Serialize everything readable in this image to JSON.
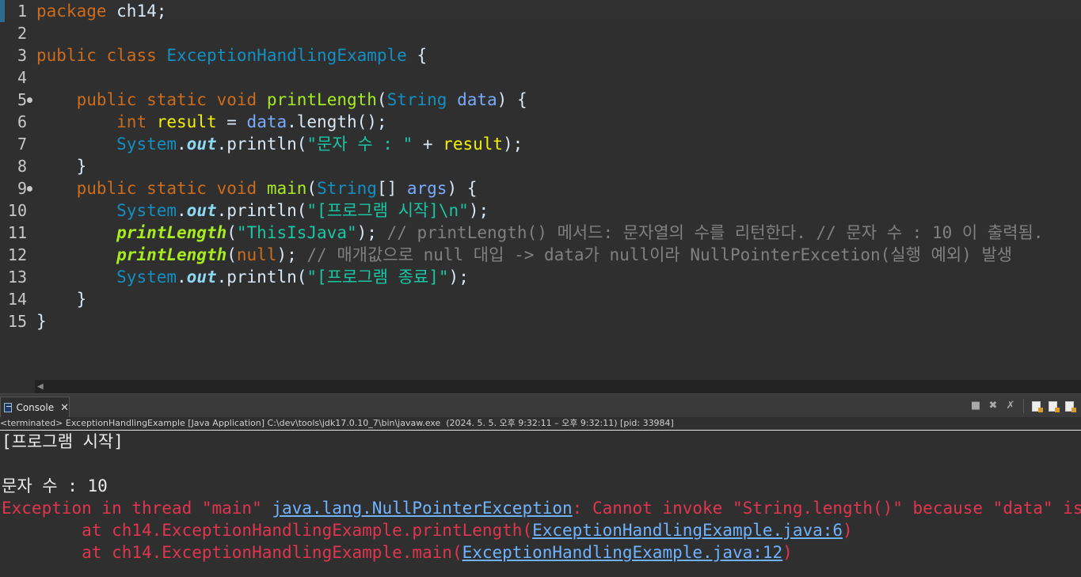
{
  "editor": {
    "lines": [
      {
        "num": "1",
        "tokens": [
          [
            "kw",
            "package"
          ],
          [
            "plain",
            " ch14;"
          ]
        ]
      },
      {
        "num": "2",
        "tokens": []
      },
      {
        "num": "3",
        "tokens": [
          [
            "kw",
            "public"
          ],
          [
            "plain",
            " "
          ],
          [
            "kw",
            "class"
          ],
          [
            "plain",
            " "
          ],
          [
            "cls",
            "ExceptionHandlingExample"
          ],
          [
            "plain",
            " {"
          ]
        ]
      },
      {
        "num": "4",
        "tokens": []
      },
      {
        "num": "5",
        "fold": true,
        "tokens": [
          [
            "plain",
            "    "
          ],
          [
            "kw",
            "public"
          ],
          [
            "plain",
            " "
          ],
          [
            "kw",
            "static"
          ],
          [
            "plain",
            " "
          ],
          [
            "kw",
            "void"
          ],
          [
            "plain",
            " "
          ],
          [
            "meth",
            "printLength"
          ],
          [
            "plain",
            "("
          ],
          [
            "type",
            "String"
          ],
          [
            "plain",
            " "
          ],
          [
            "param",
            "data"
          ],
          [
            "plain",
            ") {"
          ]
        ]
      },
      {
        "num": "6",
        "tokens": [
          [
            "plain",
            "        "
          ],
          [
            "kw",
            "int"
          ],
          [
            "plain",
            " "
          ],
          [
            "local",
            "result"
          ],
          [
            "plain",
            " = "
          ],
          [
            "param",
            "data"
          ],
          [
            "plain",
            ".length();"
          ]
        ]
      },
      {
        "num": "7",
        "tokens": [
          [
            "plain",
            "        "
          ],
          [
            "type",
            "System"
          ],
          [
            "plain",
            "."
          ],
          [
            "sfield",
            "out"
          ],
          [
            "plain",
            ".println("
          ],
          [
            "str",
            "\"문자 수 : \""
          ],
          [
            "plain",
            " + "
          ],
          [
            "local",
            "result"
          ],
          [
            "plain",
            ");"
          ]
        ]
      },
      {
        "num": "8",
        "tokens": [
          [
            "plain",
            "    }"
          ]
        ]
      },
      {
        "num": "9",
        "fold": true,
        "tokens": [
          [
            "plain",
            "    "
          ],
          [
            "kw",
            "public"
          ],
          [
            "plain",
            " "
          ],
          [
            "kw",
            "static"
          ],
          [
            "plain",
            " "
          ],
          [
            "kw",
            "void"
          ],
          [
            "plain",
            " "
          ],
          [
            "meth",
            "main"
          ],
          [
            "plain",
            "("
          ],
          [
            "type",
            "String"
          ],
          [
            "plain",
            "[] "
          ],
          [
            "param",
            "args"
          ],
          [
            "plain",
            ") {"
          ]
        ]
      },
      {
        "num": "10",
        "tokens": [
          [
            "plain",
            "        "
          ],
          [
            "type",
            "System"
          ],
          [
            "plain",
            "."
          ],
          [
            "sfield",
            "out"
          ],
          [
            "plain",
            ".println("
          ],
          [
            "str",
            "\"[프로그램 시작]\\n\""
          ],
          [
            "plain",
            ");"
          ]
        ]
      },
      {
        "num": "11",
        "tokens": [
          [
            "plain",
            "        "
          ],
          [
            "smeth",
            "printLength"
          ],
          [
            "plain",
            "("
          ],
          [
            "str",
            "\"ThisIsJava\""
          ],
          [
            "plain",
            "); "
          ],
          [
            "cmt",
            "// printLength() 메서드: 문자열의 수를 리턴한다. // 문자 수 : 10 이 출력됨."
          ]
        ]
      },
      {
        "num": "12",
        "tokens": [
          [
            "plain",
            "        "
          ],
          [
            "smeth",
            "printLength"
          ],
          [
            "plain",
            "("
          ],
          [
            "kw",
            "null"
          ],
          [
            "plain",
            "); "
          ],
          [
            "cmt",
            "// 매개값으로 null 대입 -> data가 null이라 NullPointerExcetion(실행 예외) 발생"
          ]
        ]
      },
      {
        "num": "13",
        "tokens": [
          [
            "plain",
            "        "
          ],
          [
            "type",
            "System"
          ],
          [
            "plain",
            "."
          ],
          [
            "sfield",
            "out"
          ],
          [
            "plain",
            ".println("
          ],
          [
            "str",
            "\"[프로그램 종료]\""
          ],
          [
            "plain",
            ");"
          ]
        ]
      },
      {
        "num": "14",
        "tokens": [
          [
            "plain",
            "    }"
          ]
        ]
      },
      {
        "num": "15",
        "tokens": [
          [
            "plain",
            "}"
          ]
        ]
      }
    ]
  },
  "console": {
    "tab_label": "Console",
    "status": "<terminated> ExceptionHandlingExample [Java Application] C:\\dev\\tools\\jdk17.0.10_7\\bin\\javaw.exe  (2024. 5. 5. 오후 9:32:11 – 오후 9:32:11) [pid: 33984]",
    "output": {
      "line1": "[프로그램 시작]",
      "line2": "",
      "line3": "문자 수 : 10",
      "exc_prefix": "Exception in thread \"main\" ",
      "exc_class": "java.lang.NullPointerException",
      "exc_msg": ": Cannot invoke \"String.length()\" because \"data\" is null",
      "trace1_prefix": "        at ch14.ExceptionHandlingExample.printLength(",
      "trace1_link": "ExceptionHandlingExample.java:6",
      "trace1_suffix": ")",
      "trace2_prefix": "        at ch14.ExceptionHandlingExample.main(",
      "trace2_link": "ExceptionHandlingExample.java:12",
      "trace2_suffix": ")"
    }
  },
  "colors": {
    "keyword": "#cc6c1d",
    "type": "#1290c3",
    "method_decl": "#a7ec21",
    "string": "#17c6a3",
    "comment": "#808080",
    "error": "#e0354f",
    "link": "#6fb3ff"
  }
}
